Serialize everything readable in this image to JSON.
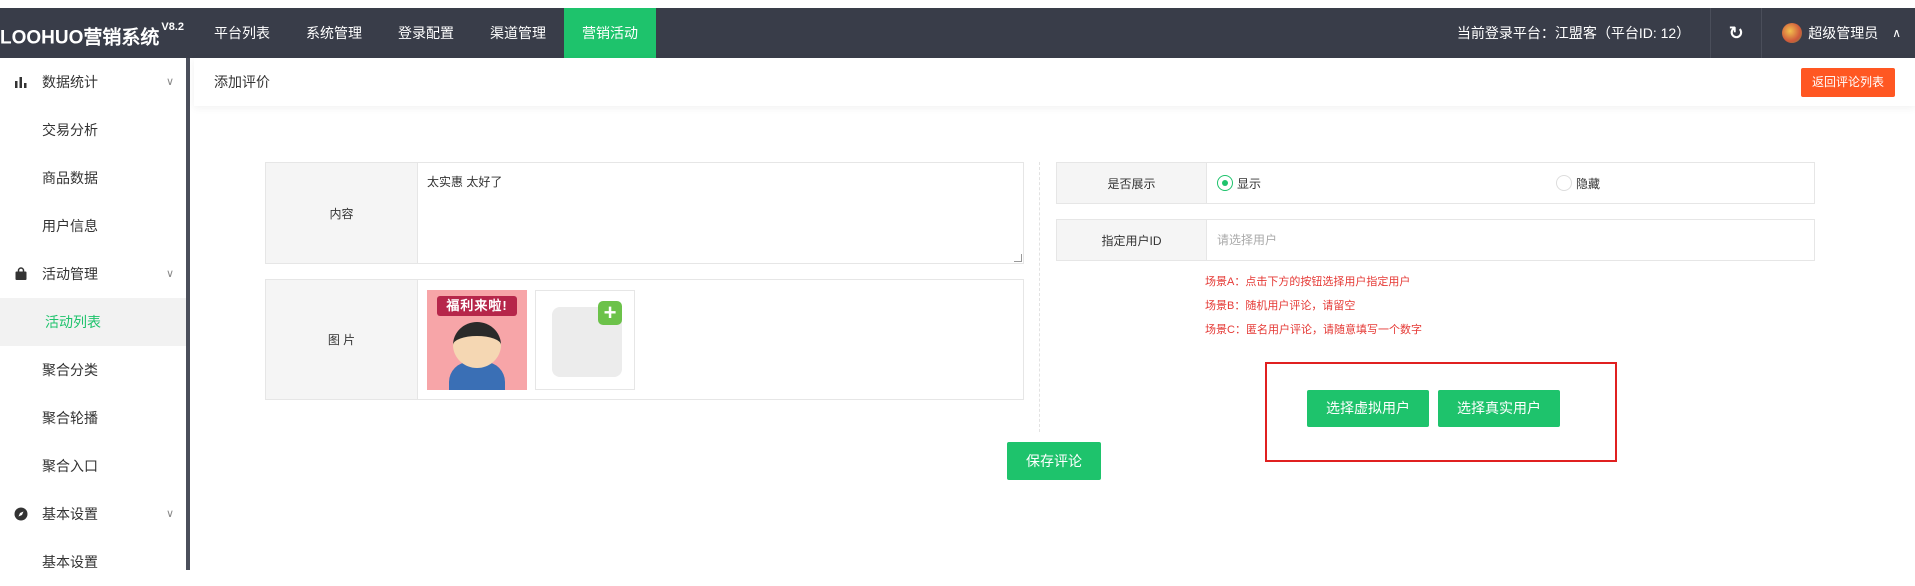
{
  "app": {
    "logo": "LOOHUO营销系统",
    "version": "V8.2"
  },
  "topnav": [
    "平台列表",
    "系统管理",
    "登录配置",
    "渠道管理",
    "营销活动"
  ],
  "header": {
    "platform_info": "当前登录平台：江盟客（平台ID: 12）",
    "username": "超级管理员"
  },
  "sidebar": {
    "group_stats": "数据统计",
    "stats_items": [
      "交易分析",
      "商品数据",
      "用户信息"
    ],
    "group_activity": "活动管理",
    "activity_items": [
      "活动列表",
      "聚合分类",
      "聚合轮播",
      "聚合入口"
    ],
    "group_basic": "基本设置",
    "basic_items": [
      "基本设置"
    ]
  },
  "page": {
    "title": "添加评价",
    "back_button": "返回评论列表"
  },
  "form": {
    "content_label": "内容",
    "content_value": "太实惠 太好了",
    "image_label": "图 片",
    "image_banner": "福利来啦!",
    "display_label": "是否展示",
    "display_options": [
      "显示",
      "隐藏"
    ],
    "display_selected": "显示",
    "user_id_label": "指定用户ID",
    "user_id_placeholder": "请选择用户",
    "scenes": [
      "场景A：点击下方的按钮选择用户指定用户",
      "场景B：随机用户评论，请留空",
      "场景C：匿名用户评论，请随意填写一个数字"
    ],
    "btn_virtual_user": "选择虚拟用户",
    "btn_real_user": "选择真实用户",
    "btn_save": "保存评论"
  },
  "colors": {
    "topbar": "#393d49",
    "accent_green": "#1ec36c",
    "back_button": "#ff5722",
    "scene_text": "#e53935",
    "highlight_box": "#e02020"
  }
}
